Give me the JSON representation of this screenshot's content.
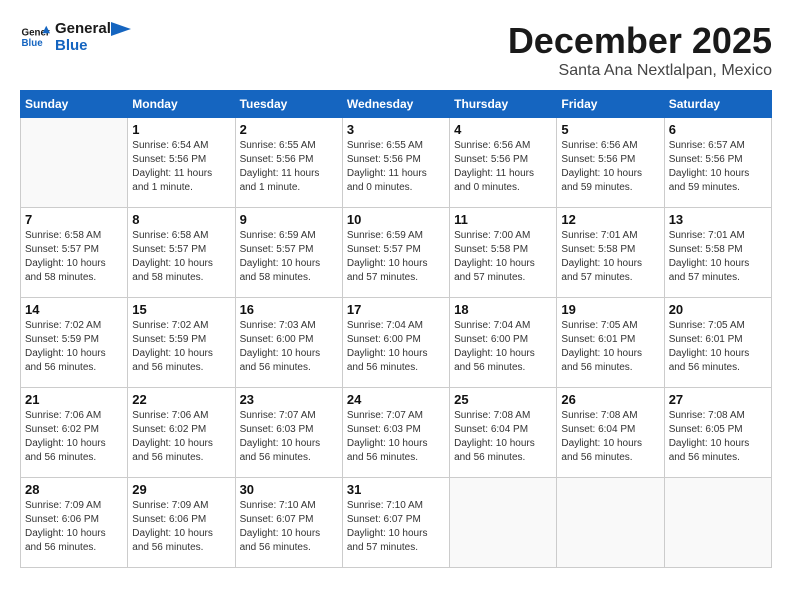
{
  "header": {
    "logo_line1": "General",
    "logo_line2": "Blue",
    "month": "December 2025",
    "location": "Santa Ana Nextlalpan, Mexico"
  },
  "weekdays": [
    "Sunday",
    "Monday",
    "Tuesday",
    "Wednesday",
    "Thursday",
    "Friday",
    "Saturday"
  ],
  "weeks": [
    [
      {
        "day": "",
        "info": ""
      },
      {
        "day": "1",
        "info": "Sunrise: 6:54 AM\nSunset: 5:56 PM\nDaylight: 11 hours\nand 1 minute."
      },
      {
        "day": "2",
        "info": "Sunrise: 6:55 AM\nSunset: 5:56 PM\nDaylight: 11 hours\nand 1 minute."
      },
      {
        "day": "3",
        "info": "Sunrise: 6:55 AM\nSunset: 5:56 PM\nDaylight: 11 hours\nand 0 minutes."
      },
      {
        "day": "4",
        "info": "Sunrise: 6:56 AM\nSunset: 5:56 PM\nDaylight: 11 hours\nand 0 minutes."
      },
      {
        "day": "5",
        "info": "Sunrise: 6:56 AM\nSunset: 5:56 PM\nDaylight: 10 hours\nand 59 minutes."
      },
      {
        "day": "6",
        "info": "Sunrise: 6:57 AM\nSunset: 5:56 PM\nDaylight: 10 hours\nand 59 minutes."
      }
    ],
    [
      {
        "day": "7",
        "info": "Sunrise: 6:58 AM\nSunset: 5:57 PM\nDaylight: 10 hours\nand 58 minutes."
      },
      {
        "day": "8",
        "info": "Sunrise: 6:58 AM\nSunset: 5:57 PM\nDaylight: 10 hours\nand 58 minutes."
      },
      {
        "day": "9",
        "info": "Sunrise: 6:59 AM\nSunset: 5:57 PM\nDaylight: 10 hours\nand 58 minutes."
      },
      {
        "day": "10",
        "info": "Sunrise: 6:59 AM\nSunset: 5:57 PM\nDaylight: 10 hours\nand 57 minutes."
      },
      {
        "day": "11",
        "info": "Sunrise: 7:00 AM\nSunset: 5:58 PM\nDaylight: 10 hours\nand 57 minutes."
      },
      {
        "day": "12",
        "info": "Sunrise: 7:01 AM\nSunset: 5:58 PM\nDaylight: 10 hours\nand 57 minutes."
      },
      {
        "day": "13",
        "info": "Sunrise: 7:01 AM\nSunset: 5:58 PM\nDaylight: 10 hours\nand 57 minutes."
      }
    ],
    [
      {
        "day": "14",
        "info": "Sunrise: 7:02 AM\nSunset: 5:59 PM\nDaylight: 10 hours\nand 56 minutes."
      },
      {
        "day": "15",
        "info": "Sunrise: 7:02 AM\nSunset: 5:59 PM\nDaylight: 10 hours\nand 56 minutes."
      },
      {
        "day": "16",
        "info": "Sunrise: 7:03 AM\nSunset: 6:00 PM\nDaylight: 10 hours\nand 56 minutes."
      },
      {
        "day": "17",
        "info": "Sunrise: 7:04 AM\nSunset: 6:00 PM\nDaylight: 10 hours\nand 56 minutes."
      },
      {
        "day": "18",
        "info": "Sunrise: 7:04 AM\nSunset: 6:00 PM\nDaylight: 10 hours\nand 56 minutes."
      },
      {
        "day": "19",
        "info": "Sunrise: 7:05 AM\nSunset: 6:01 PM\nDaylight: 10 hours\nand 56 minutes."
      },
      {
        "day": "20",
        "info": "Sunrise: 7:05 AM\nSunset: 6:01 PM\nDaylight: 10 hours\nand 56 minutes."
      }
    ],
    [
      {
        "day": "21",
        "info": "Sunrise: 7:06 AM\nSunset: 6:02 PM\nDaylight: 10 hours\nand 56 minutes."
      },
      {
        "day": "22",
        "info": "Sunrise: 7:06 AM\nSunset: 6:02 PM\nDaylight: 10 hours\nand 56 minutes."
      },
      {
        "day": "23",
        "info": "Sunrise: 7:07 AM\nSunset: 6:03 PM\nDaylight: 10 hours\nand 56 minutes."
      },
      {
        "day": "24",
        "info": "Sunrise: 7:07 AM\nSunset: 6:03 PM\nDaylight: 10 hours\nand 56 minutes."
      },
      {
        "day": "25",
        "info": "Sunrise: 7:08 AM\nSunset: 6:04 PM\nDaylight: 10 hours\nand 56 minutes."
      },
      {
        "day": "26",
        "info": "Sunrise: 7:08 AM\nSunset: 6:04 PM\nDaylight: 10 hours\nand 56 minutes."
      },
      {
        "day": "27",
        "info": "Sunrise: 7:08 AM\nSunset: 6:05 PM\nDaylight: 10 hours\nand 56 minutes."
      }
    ],
    [
      {
        "day": "28",
        "info": "Sunrise: 7:09 AM\nSunset: 6:06 PM\nDaylight: 10 hours\nand 56 minutes."
      },
      {
        "day": "29",
        "info": "Sunrise: 7:09 AM\nSunset: 6:06 PM\nDaylight: 10 hours\nand 56 minutes."
      },
      {
        "day": "30",
        "info": "Sunrise: 7:10 AM\nSunset: 6:07 PM\nDaylight: 10 hours\nand 56 minutes."
      },
      {
        "day": "31",
        "info": "Sunrise: 7:10 AM\nSunset: 6:07 PM\nDaylight: 10 hours\nand 57 minutes."
      },
      {
        "day": "",
        "info": ""
      },
      {
        "day": "",
        "info": ""
      },
      {
        "day": "",
        "info": ""
      }
    ]
  ]
}
